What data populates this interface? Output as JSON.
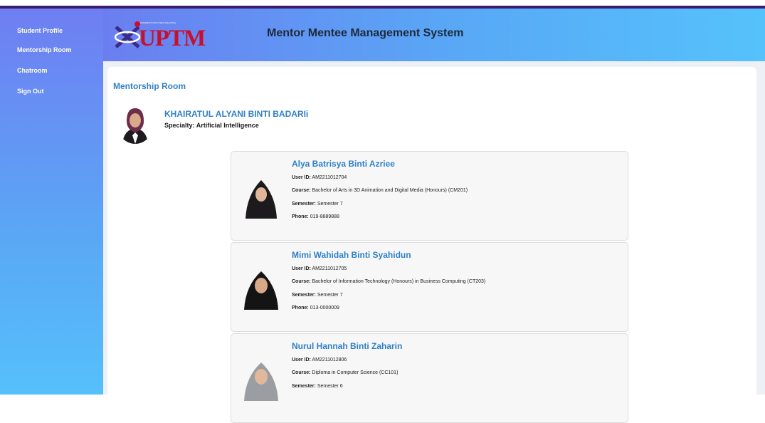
{
  "sidebar": {
    "items": [
      {
        "label": "Student Profile"
      },
      {
        "label": "Mentorship Room"
      },
      {
        "label": "Chatroom"
      },
      {
        "label": "Sign Out"
      }
    ]
  },
  "header": {
    "logo_text": "UPTM",
    "logo_tagline": "UNIVERSITI POLY-TECH MALAYSIA",
    "title": "Mentor Mentee Management System"
  },
  "main": {
    "title": "Mentorship Room",
    "mentor": {
      "name": "KHAIRATUL ALYANI BINTI BADARIi",
      "specialty_label": "Specialty:",
      "specialty": "Artificial Intelligence"
    },
    "labels": {
      "user_id": "User ID:",
      "course": "Course:",
      "semester": "Semester:",
      "phone": "Phone:"
    },
    "mentees": [
      {
        "name": "Alya Batrisya Binti Azriee",
        "user_id": "AM2211012704",
        "course": "Bachelor of Arts in 3D Animation and Digital Media (Honours) (CM201)",
        "semester": "Semester 7",
        "phone": "019-8889888",
        "hijab_color": "#1c1a1c"
      },
      {
        "name": "Mimi Wahidah Binti Syahidun",
        "user_id": "AM2211012705",
        "course": "Bachelor of Information Technology (Honours) in Business Computing (CT203)",
        "semester": "Semester 7",
        "phone": "013-0000009",
        "hijab_color": "#141414"
      },
      {
        "name": "Nurul Hannah Binti Zaharin",
        "user_id": "AM2211012806",
        "course": "Diploma in Computer Science (CC101)",
        "semester": "Semester 6",
        "phone": "",
        "hijab_color": "#9a9ea3"
      }
    ]
  },
  "colors": {
    "accent": "#2f80c8",
    "topbar": "#3b1c6e",
    "logo_red": "#c8102e"
  }
}
